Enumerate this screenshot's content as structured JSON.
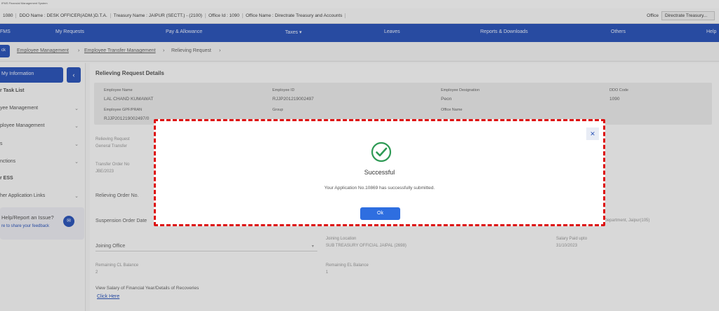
{
  "header": {
    "brand_text": "IFMS Financial Management System",
    "info_segments": [
      "1080",
      "DDO Name : DESK OFFICER(ADM.)D.T.A.",
      "Treasury Name : JAIPUR (SECTT.) - (2100)",
      "Office Id : 1090",
      "Office Name : Directrate Treasury and Accounts"
    ],
    "office_label": "Office",
    "office_value": "Directrate Treasury..."
  },
  "nav": {
    "logo": "FMS",
    "items": [
      "My Requests",
      "Pay & Allowance",
      "Taxes",
      "Leaves",
      "Reports & Downloads",
      "Others",
      "Help"
    ],
    "taxes_caret": "▾"
  },
  "breadcrumb": {
    "back": "ck",
    "items": [
      "Employee Management",
      "Employee Transfer Management",
      "Relieving Request"
    ]
  },
  "sidebar": {
    "my_information": "My Information",
    "collapse": "‹",
    "items": [
      "r Task List",
      "yee Management",
      "ployee Management",
      "s",
      "nctions",
      "r ESS",
      "her Application Links"
    ],
    "feedback_title": "Help/Report an Issue?",
    "feedback_sub": "re to share your feedback"
  },
  "content": {
    "title": "Relieving Request Details",
    "fields": {
      "employee_name_label": "Employee Name",
      "employee_name": "LAL CHAND KUMAWAT",
      "employee_id_label": "Employee ID",
      "employee_id": "RJJP201219002497",
      "designation_label": "Employee Designation",
      "designation": "Peon",
      "ddo_code_label": "DDO Code",
      "ddo_code": "1090",
      "gpf_label": "Employee GPF/PRAN",
      "gpf": "RJJP201219002497/0",
      "group_label": "Group",
      "office_name_label": "Office Name",
      "relieving_request_label": "Relieving Request",
      "relieving_request": "General Transfer",
      "transfer_order_label": "Transfer Order No",
      "transfer_order": "JBE/2023",
      "relieving_order_label": "Relieving Order No.",
      "suspension_label": "Suspension Order Date",
      "joining_office_label": "Joining Office",
      "joining_location_label": "Joining Location",
      "joining_location": "SUB TREASURY OFFICIAL JAIPAL (2698)",
      "salary_label": "Salary Paid upto",
      "salary": "31/10/2023",
      "remaining_cl_label": "Remaining CL Balance",
      "remaining_cl": "2",
      "remaining_el_label": "Remaining EL Balance",
      "remaining_el": "1",
      "dept_partial": "ts Department, Jaipur(105)",
      "view_salary_label": "View Salary of Financial Year/Details of Recoveries",
      "click_here": "Click Here"
    }
  },
  "modal": {
    "title": "Successful",
    "message": "Your Application No.10869 has successfully submitted.",
    "ok_label": "Ok",
    "close_label": "✕"
  },
  "colors": {
    "nav_blue": "#2e56b8",
    "ok_blue": "#2e6ee0",
    "success_green": "#2e9a55",
    "highlight_red": "#d11111"
  }
}
